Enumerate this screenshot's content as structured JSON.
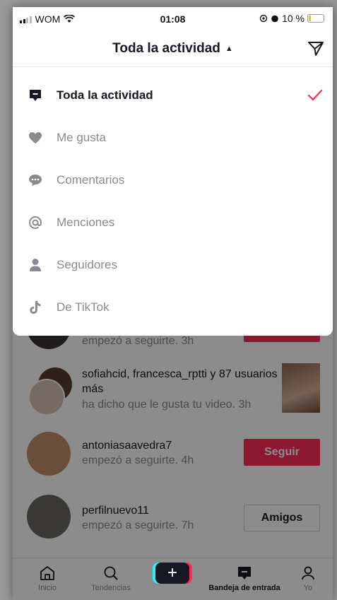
{
  "status_bar": {
    "carrier": "WOM",
    "time": "01:08",
    "battery": "10 %"
  },
  "header": {
    "title": "Toda la actividad"
  },
  "menu": {
    "items": [
      {
        "label": "Toda la actividad",
        "icon": "inbox-icon"
      },
      {
        "label": "Me gusta",
        "icon": "heart-icon"
      },
      {
        "label": "Comentarios",
        "icon": "comment-icon"
      },
      {
        "label": "Menciones",
        "icon": "at-icon"
      },
      {
        "label": "Seguidores",
        "icon": "person-icon"
      },
      {
        "label": "De TikTok",
        "icon": "tiktok-icon"
      }
    ],
    "selected": "Toda la actividad"
  },
  "inbox": {
    "partial_row": {
      "subtitle": "empezó a seguirte. 3h"
    },
    "rows": [
      {
        "title": "sofiahcid, francesca_rptti y 87 usuarios más",
        "subtitle": "ha dicho que le gusta tu video. 3h"
      },
      {
        "title": "antoniasaavedra7",
        "subtitle": "empezó a seguirte. 4h",
        "button": "Seguir"
      },
      {
        "title": "perfilnuevo11",
        "subtitle": "empezó a seguirte. 7h",
        "button": "Amigos"
      }
    ]
  },
  "bottom_nav": {
    "items": [
      {
        "label": "Inicio"
      },
      {
        "label": "Tendencias"
      },
      {
        "label": ""
      },
      {
        "label": "Bandeja de entrada"
      },
      {
        "label": "Yo"
      }
    ]
  },
  "colors": {
    "accent": "#fe2c55",
    "text": "#161823",
    "muted": "#8a8b91"
  }
}
